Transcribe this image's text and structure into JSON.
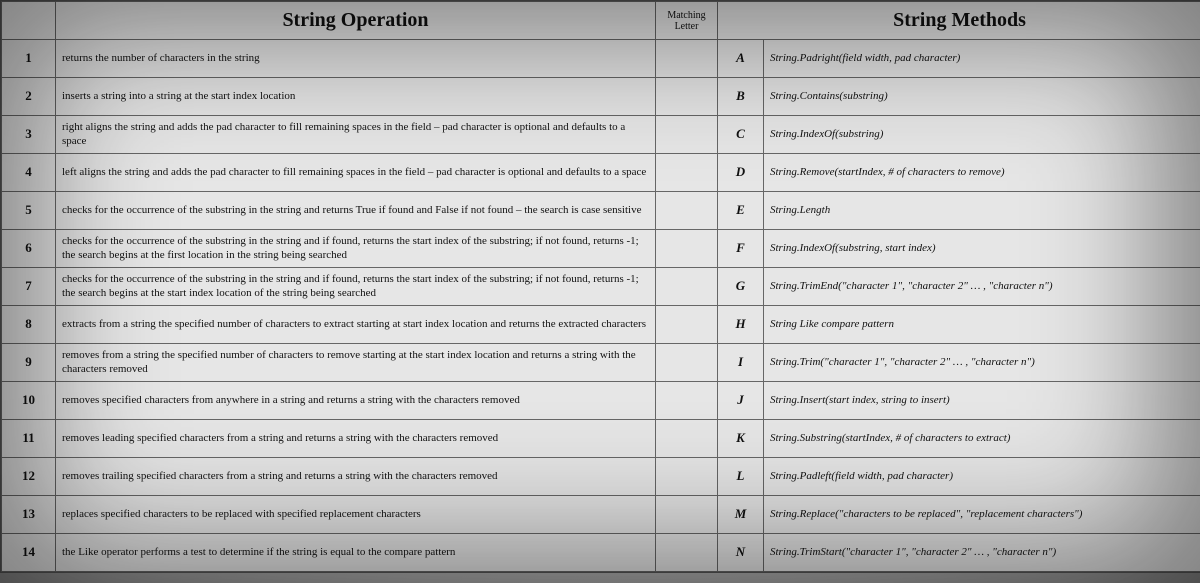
{
  "headers": {
    "operation": "String Operation",
    "matching": "Matching Letter",
    "methods": "String Methods"
  },
  "rows": [
    {
      "num": "1",
      "desc": "returns the number of characters in the string",
      "letter": "A",
      "method": "String.Padright(field width, pad character)"
    },
    {
      "num": "2",
      "desc": "inserts a string into a string at the start index location",
      "letter": "B",
      "method": "String.Contains(substring)"
    },
    {
      "num": "3",
      "desc": "right aligns the string and adds the pad character to fill remaining spaces in the field – pad character is optional and defaults to a space",
      "letter": "C",
      "method": "String.IndexOf(substring)"
    },
    {
      "num": "4",
      "desc": "left aligns the string and adds the pad character to fill remaining spaces in the field – pad character is optional and defaults to a space",
      "letter": "D",
      "method": "String.Remove(startIndex, # of characters to remove)"
    },
    {
      "num": "5",
      "desc": "checks for the occurrence of the substring in the string and returns True if found and False if not found – the search is case sensitive",
      "letter": "E",
      "method": "String.Length"
    },
    {
      "num": "6",
      "desc": "checks for the occurrence of the substring in the string and if found, returns the start index of the substring; if not found, returns -1; the search begins at the first location in the string being searched",
      "letter": "F",
      "method": "String.IndexOf(substring, start index)"
    },
    {
      "num": "7",
      "desc": "checks for the occurrence of the substring in the string and if found, returns the start index of the substring; if not found, returns -1; the search begins at the start index location of the string being searched",
      "letter": "G",
      "method": "String.TrimEnd(\"character 1\", \"character 2\" … , \"character n\")"
    },
    {
      "num": "8",
      "desc": "extracts from a string the specified number of characters to extract starting at start index location and returns the extracted characters",
      "letter": "H",
      "method": "String Like compare pattern"
    },
    {
      "num": "9",
      "desc": "removes from a string the specified number of characters to remove starting at the start index location and returns a string with the characters removed",
      "letter": "I",
      "method": "String.Trim(\"character 1\", \"character 2\" … , \"character n\")"
    },
    {
      "num": "10",
      "desc": "removes specified characters from anywhere in a string and returns a string with the characters removed",
      "letter": "J",
      "method": "String.Insert(start index, string to insert)"
    },
    {
      "num": "11",
      "desc": "removes leading specified characters from a string and returns a string with the characters removed",
      "letter": "K",
      "method": "String.Substring(startIndex, # of characters to extract)"
    },
    {
      "num": "12",
      "desc": "removes trailing specified characters from a string and returns a string with the characters removed",
      "letter": "L",
      "method": "String.Padleft(field width, pad character)"
    },
    {
      "num": "13",
      "desc": "replaces specified characters to be replaced with specified replacement characters",
      "letter": "M",
      "method": "String.Replace(\"characters to be replaced\", \"replacement characters\")"
    },
    {
      "num": "14",
      "desc": "the Like operator performs a test to determine if the string is equal to the compare pattern",
      "letter": "N",
      "method": "String.TrimStart(\"character 1\", \"character 2\" … , \"character n\")"
    }
  ]
}
